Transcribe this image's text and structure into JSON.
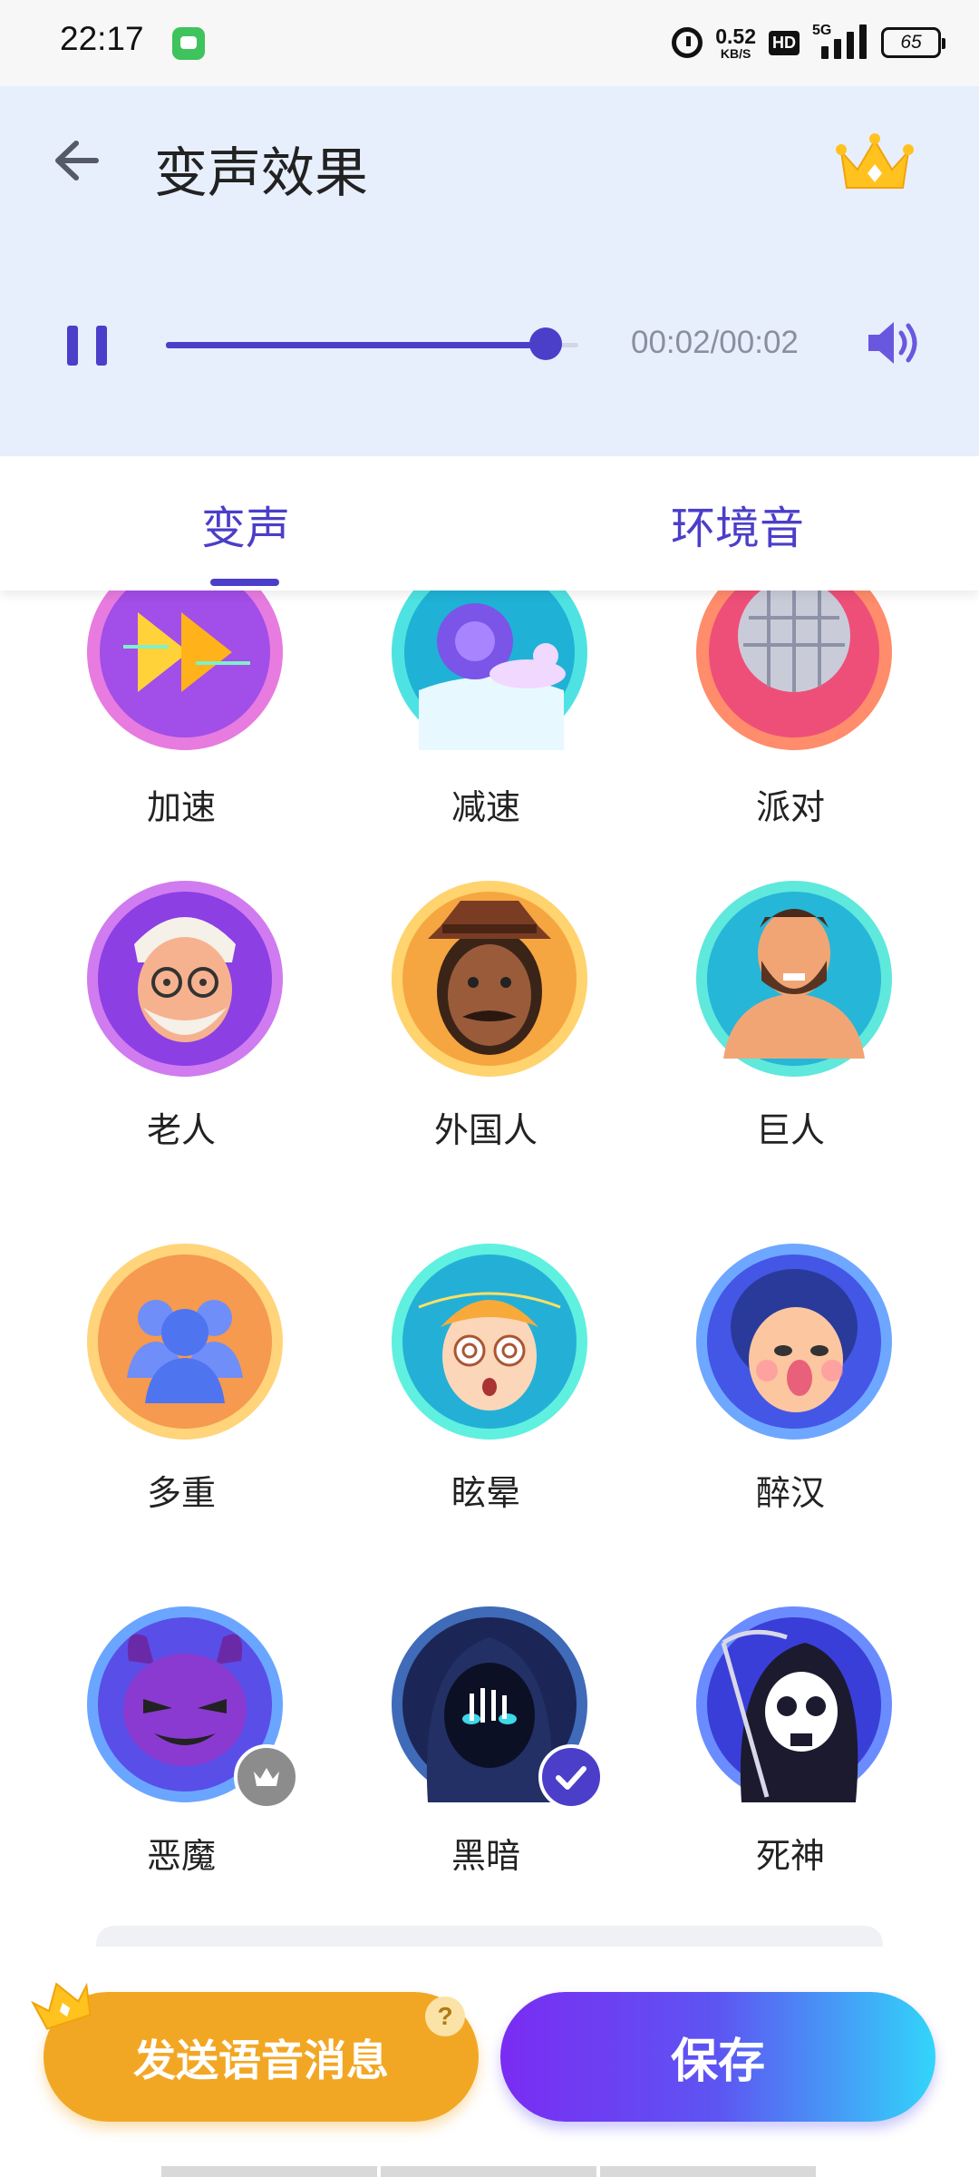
{
  "status_bar": {
    "time": "22:17",
    "net_speed_value": "0.52",
    "net_speed_unit": "KB/S",
    "hd_label": "HD",
    "network_label": "5G",
    "battery_level": "65"
  },
  "header": {
    "title": "变声效果",
    "player": {
      "time_text": "00:02/00:02",
      "progress_percent": 92
    }
  },
  "tabs": [
    {
      "label": "变声",
      "active": true
    },
    {
      "label": "环境音",
      "active": false
    }
  ],
  "effects": [
    {
      "label": "加速",
      "icon": "fast-forward-icon",
      "bg": [
        "#e77be0",
        "#a24ee8"
      ]
    },
    {
      "label": "减速",
      "icon": "snail-icon",
      "bg": [
        "#4ee3e2",
        "#1fb2d6"
      ]
    },
    {
      "label": "派对",
      "icon": "disco-ball-icon",
      "bg": [
        "#ff8c6b",
        "#ee4f78"
      ]
    },
    {
      "label": "老人",
      "icon": "old-man-icon",
      "bg": [
        "#d07bf0",
        "#8c3fe3"
      ]
    },
    {
      "label": "外国人",
      "icon": "foreigner-icon",
      "bg": [
        "#ffd36e",
        "#f6a640"
      ]
    },
    {
      "label": "巨人",
      "icon": "giant-icon",
      "bg": [
        "#5fe8dc",
        "#26b6d8"
      ]
    },
    {
      "label": "多重",
      "icon": "crowd-icon",
      "bg": [
        "#ffd47a",
        "#f59a4f"
      ]
    },
    {
      "label": "眩晕",
      "icon": "dizzy-icon",
      "bg": [
        "#5ff0e0",
        "#24b0d6"
      ]
    },
    {
      "label": "醉汉",
      "icon": "drunk-icon",
      "bg": [
        "#6ea7ff",
        "#4456e6"
      ]
    },
    {
      "label": "恶魔",
      "icon": "devil-icon",
      "bg": [
        "#6aa6ff",
        "#5a4ee8"
      ],
      "badge": "vip"
    },
    {
      "label": "黑暗",
      "icon": "dark-hood-icon",
      "bg": [
        "#3f6bb8",
        "#1b2656"
      ],
      "badge": "selected"
    },
    {
      "label": "死神",
      "icon": "reaper-icon",
      "bg": [
        "#6b8cff",
        "#3a3ed8"
      ]
    }
  ],
  "buttons": {
    "send_label": "发送语音消息",
    "help_glyph": "?",
    "save_label": "保存"
  },
  "colors": {
    "accent": "#4b3ec9",
    "header_bg": "#e8effc",
    "send_button": "#f2a724",
    "crown": "#ffc21f"
  }
}
